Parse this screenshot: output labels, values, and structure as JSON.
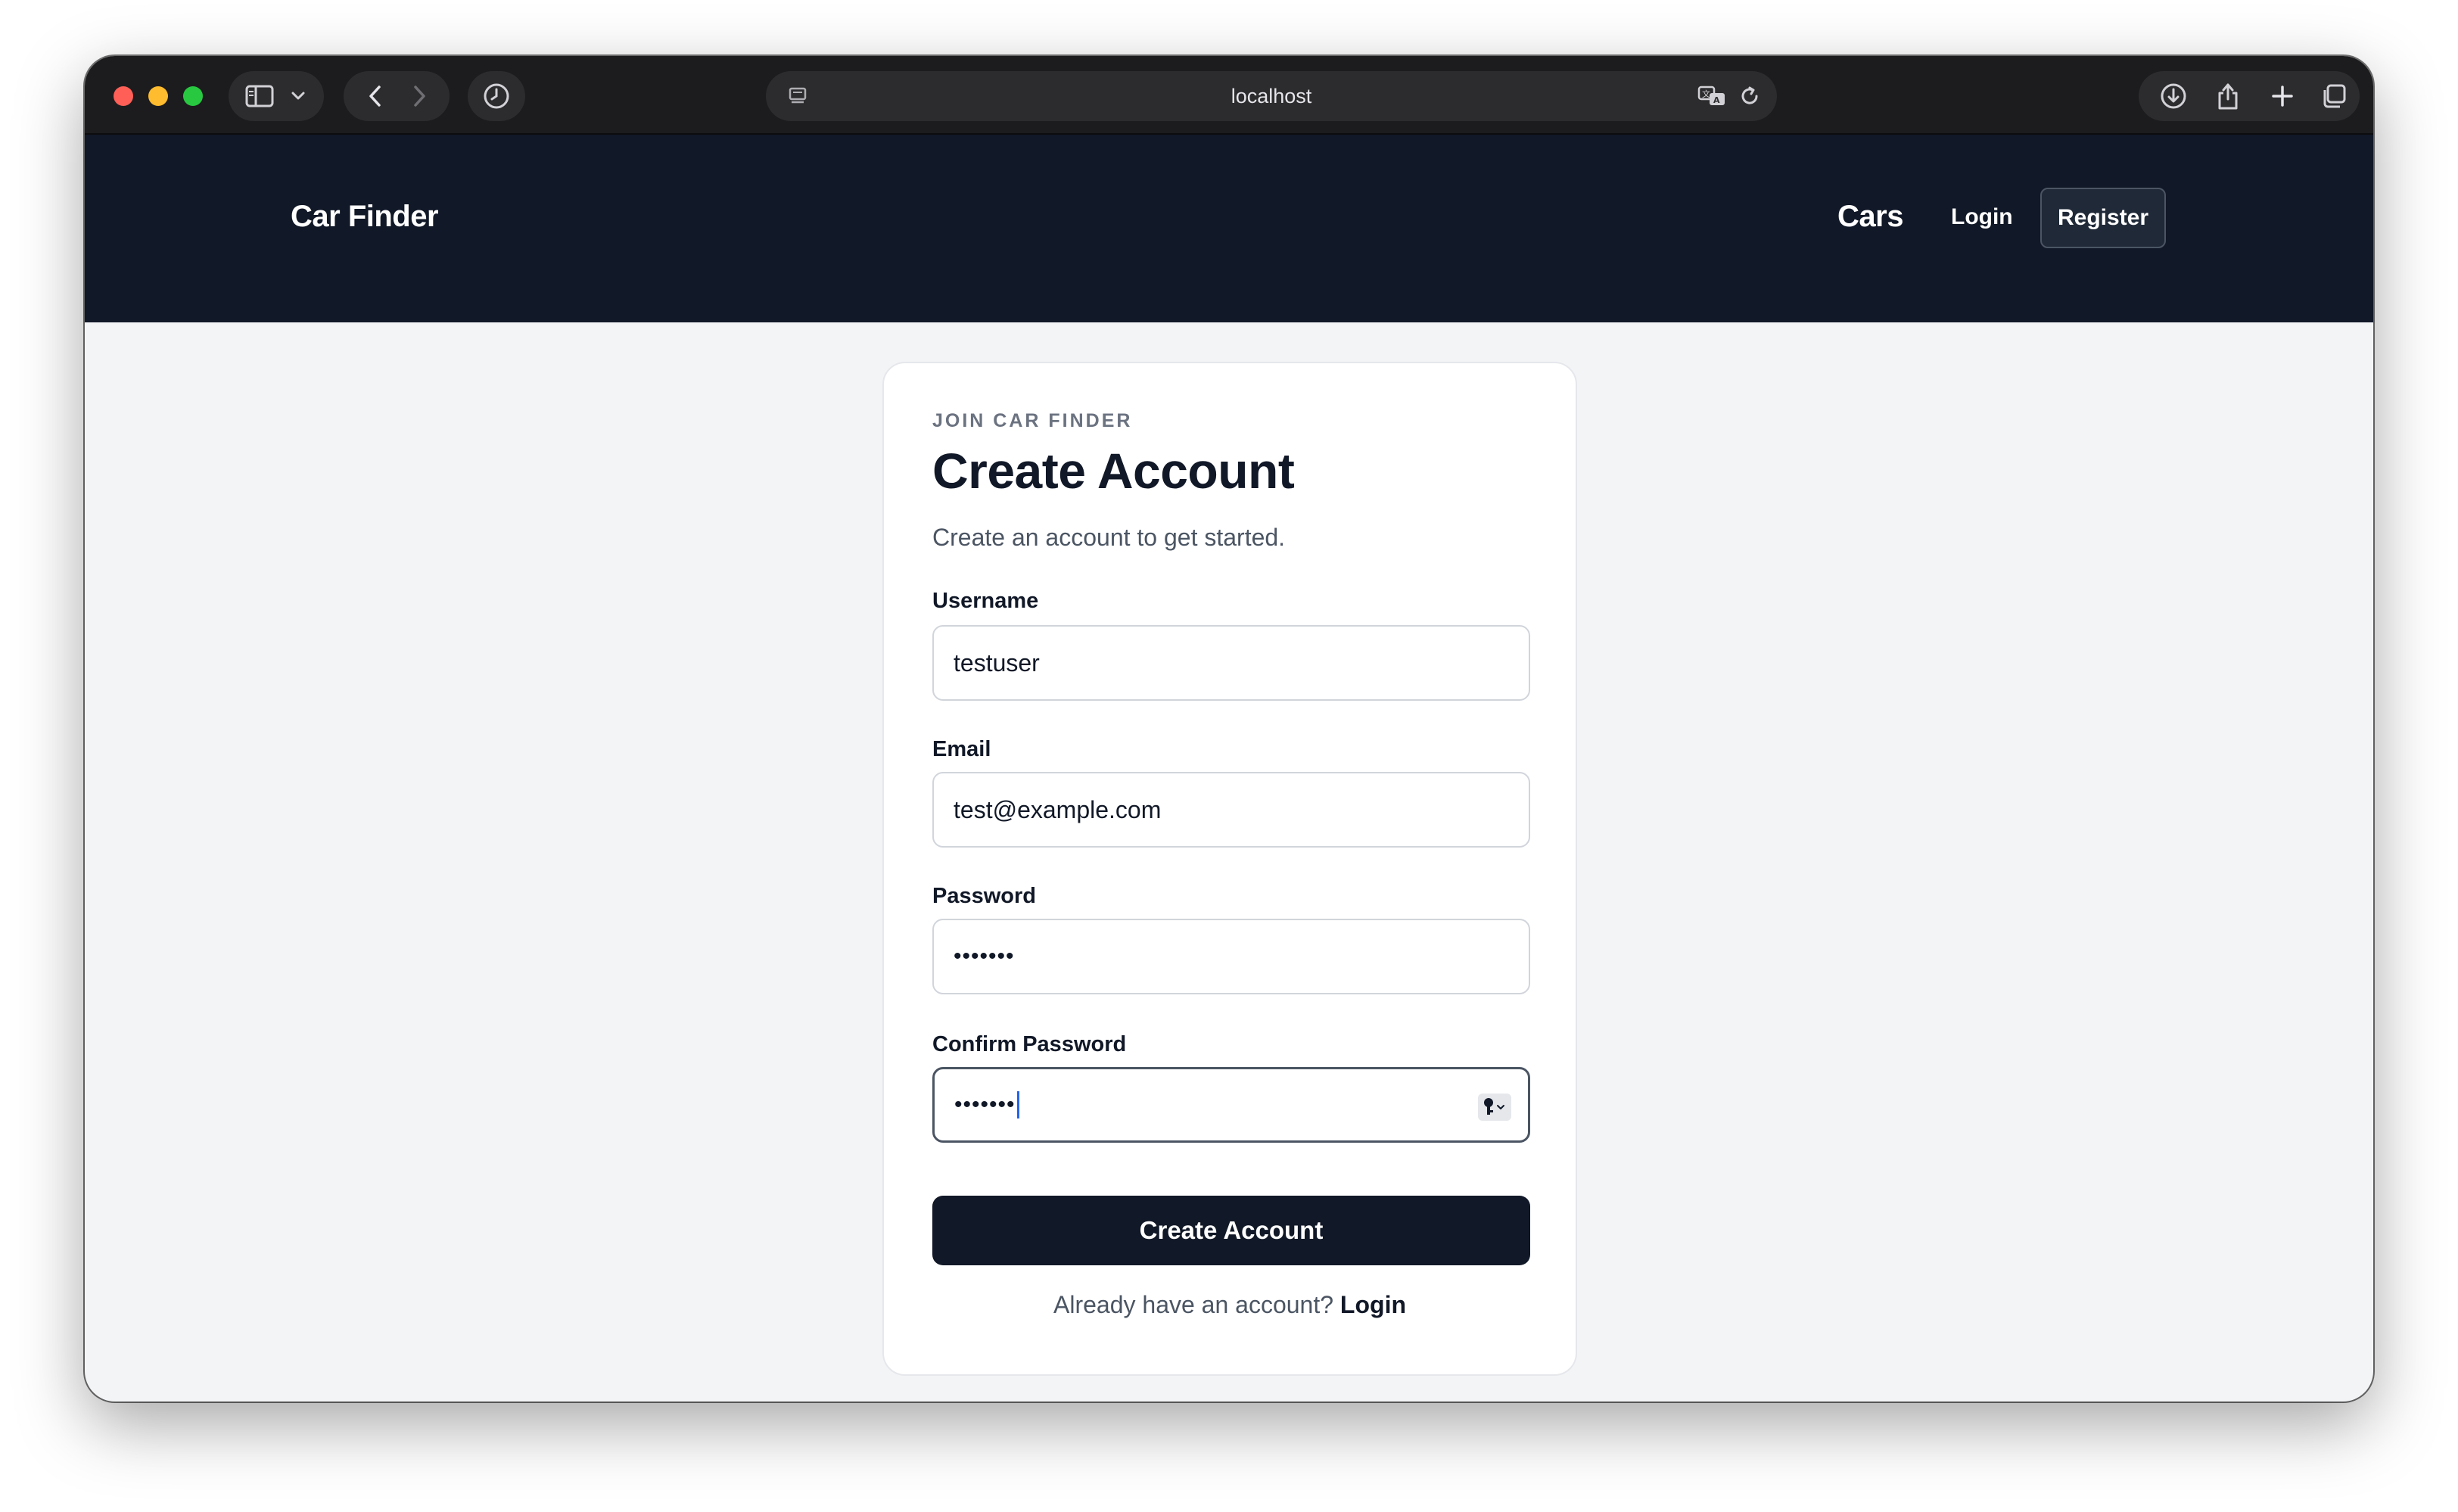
{
  "browser": {
    "url": "localhost"
  },
  "site": {
    "brand": "Car Finder",
    "nav": {
      "cars": "Cars",
      "login": "Login",
      "register": "Register"
    }
  },
  "form": {
    "eyebrow": "JOIN CAR FINDER",
    "title": "Create Account",
    "subtitle": "Create an account to get started.",
    "fields": {
      "username": {
        "label": "Username",
        "value": "testuser"
      },
      "email": {
        "label": "Email",
        "value": "test@example.com"
      },
      "password": {
        "label": "Password",
        "value": "•••••••"
      },
      "confirm_password": {
        "label": "Confirm Password",
        "value": "•••••••"
      }
    },
    "submit_label": "Create Account",
    "footer_prompt": "Already have an account?",
    "footer_link": "Login"
  },
  "colors": {
    "nav_background": "#111827",
    "page_background": "#f3f4f6",
    "button_background": "#111827",
    "focus_caret": "#2563eb"
  },
  "icons": {
    "password_manager": "key-icon"
  }
}
